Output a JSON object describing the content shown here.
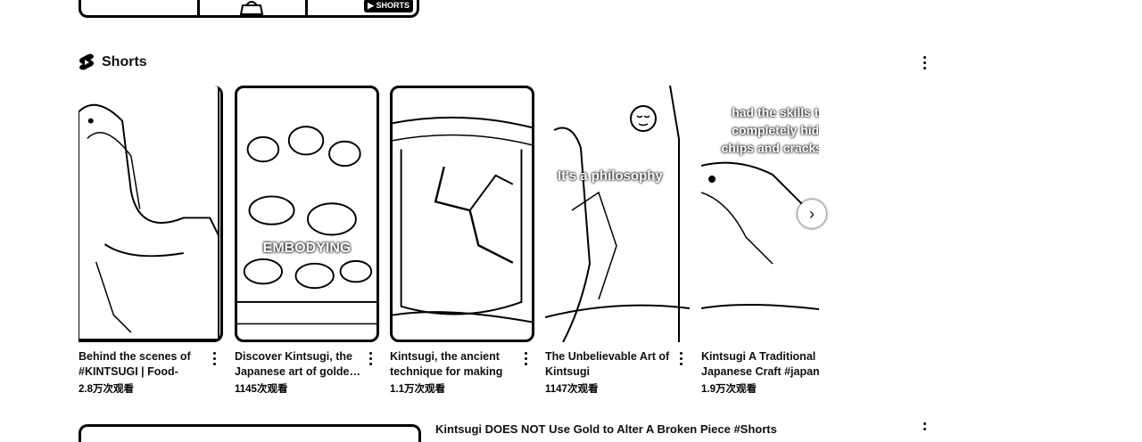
{
  "top": {
    "badge": "SHORTS"
  },
  "section": {
    "title": "Shorts"
  },
  "shorts": [
    {
      "title": "Behind the scenes of #KINTSUGI | Food-safe…",
      "views": "2.8万次观看",
      "overlay": ""
    },
    {
      "title": "Discover Kintsugi, the Japanese art of golde…",
      "views": "1145次观看",
      "overlay": "EMBODYING"
    },
    {
      "title": "Kintsugi, the ancient technique for making …",
      "views": "1.1万次观看",
      "overlay": ""
    },
    {
      "title": "The Unbelievable Art of Kintsugi",
      "views": "1147次观看",
      "overlay": "It's a philosophy"
    },
    {
      "title": "Kintsugi A Traditional Japanese Craft #japan.",
      "views": "1.9万次观看",
      "overlay": "had the skills to completely hide chips and cracks."
    }
  ],
  "bottom": {
    "title": "Kintsugi DOES NOT Use Gold to Alter A Broken Piece #Shorts"
  },
  "icons": {
    "shorts_logo": "shorts-icon",
    "menu": "more-vert-icon",
    "next": "chevron-right-icon",
    "emoji": "relieved-face-icon"
  },
  "colors": {
    "text": "#0f0f0f",
    "badge_bg": "#000000"
  }
}
